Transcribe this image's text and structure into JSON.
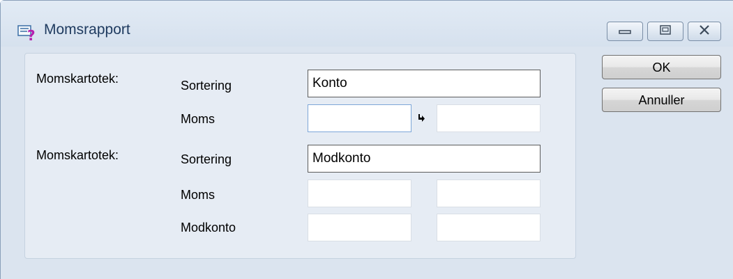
{
  "window": {
    "title": "Momsrapport",
    "icon": "report-icon"
  },
  "caption_buttons": {
    "minimize_icon": "minimize-icon",
    "maximize_icon": "maximize-icon",
    "close_icon": "close-icon"
  },
  "section1": {
    "label": "Momskartotek:",
    "sort_label": "Sortering",
    "sort_value": "Konto",
    "moms_label": "Moms",
    "moms_from": "",
    "moms_to": "",
    "arrow_icon": "arrow-right-icon"
  },
  "section2": {
    "label": "Momskartotek:",
    "sort_label": "Sortering",
    "sort_value": "Modkonto",
    "moms_label": "Moms",
    "moms_from": "",
    "moms_to": "",
    "modkonto_label": "Modkonto",
    "modkonto_from": "",
    "modkonto_to": ""
  },
  "buttons": {
    "ok": "OK",
    "cancel": "Annuller"
  }
}
